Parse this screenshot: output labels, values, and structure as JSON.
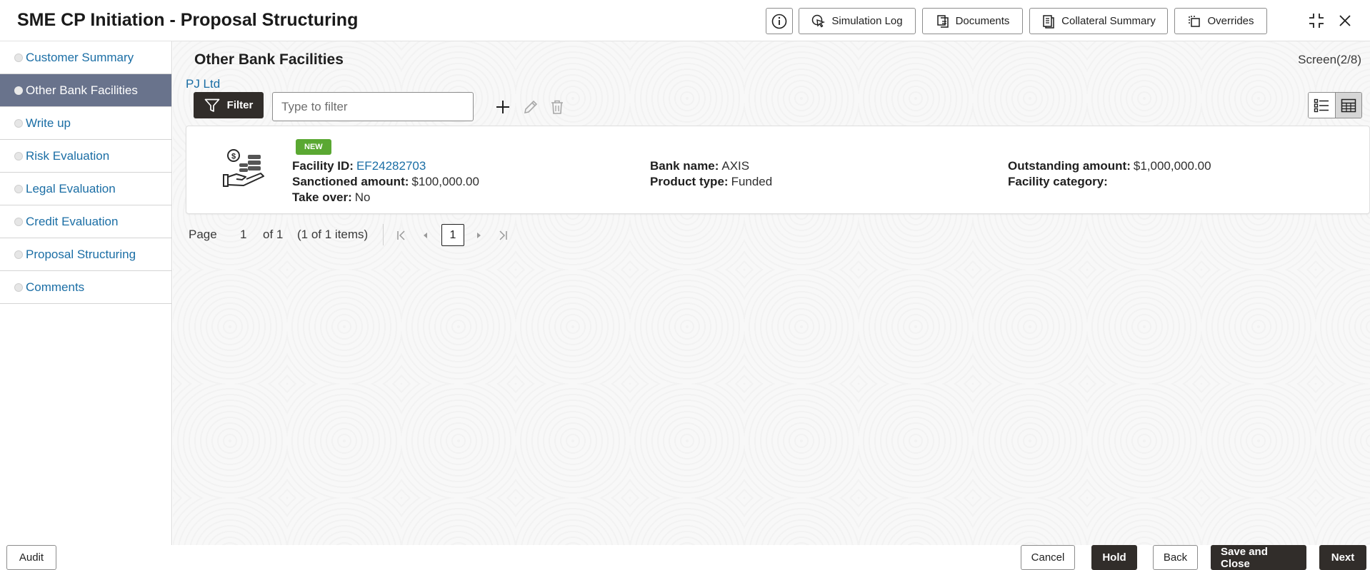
{
  "header": {
    "title": "SME CP Initiation - Proposal Structuring",
    "buttons": {
      "simulation_log": "Simulation Log",
      "documents": "Documents",
      "collateral_summary": "Collateral Summary",
      "overrides": "Overrides"
    }
  },
  "sidebar": {
    "items": [
      {
        "label": "Customer Summary"
      },
      {
        "label": "Other Bank Facilities"
      },
      {
        "label": "Write up"
      },
      {
        "label": "Risk Evaluation"
      },
      {
        "label": "Legal Evaluation"
      },
      {
        "label": "Credit Evaluation"
      },
      {
        "label": "Proposal Structuring"
      },
      {
        "label": "Comments"
      }
    ]
  },
  "main": {
    "title": "Other Bank Facilities",
    "screen_count": "Screen(2/8)",
    "customer": "PJ Ltd",
    "filter": {
      "button_label": "Filter",
      "placeholder": "Type to filter"
    },
    "card": {
      "badge": "NEW",
      "facility_id_label": "Facility ID:",
      "facility_id": "EF24282703",
      "sanctioned_label": "Sanctioned amount:",
      "sanctioned": "$100,000.00",
      "takeover_label": "Take over:",
      "takeover": "No",
      "bank_label": "Bank name:",
      "bank": "AXIS",
      "product_label": "Product type:",
      "product": "Funded",
      "outstanding_label": "Outstanding amount:",
      "outstanding": "$1,000,000.00",
      "category_label": "Facility category:",
      "category": ""
    },
    "pager": {
      "page_label": "Page",
      "page_value": "1",
      "of_label": "of 1",
      "items_label": "(1 of 1 items)",
      "current": "1"
    }
  },
  "footer": {
    "audit": "Audit",
    "cancel": "Cancel",
    "hold": "Hold",
    "back": "Back",
    "save_close": "Save and Close",
    "next": "Next"
  },
  "colors": {
    "accent_link": "#1b6ea5",
    "active_nav": "#69738c",
    "dark_button": "#312d2a",
    "badge_new": "#5aa832"
  }
}
